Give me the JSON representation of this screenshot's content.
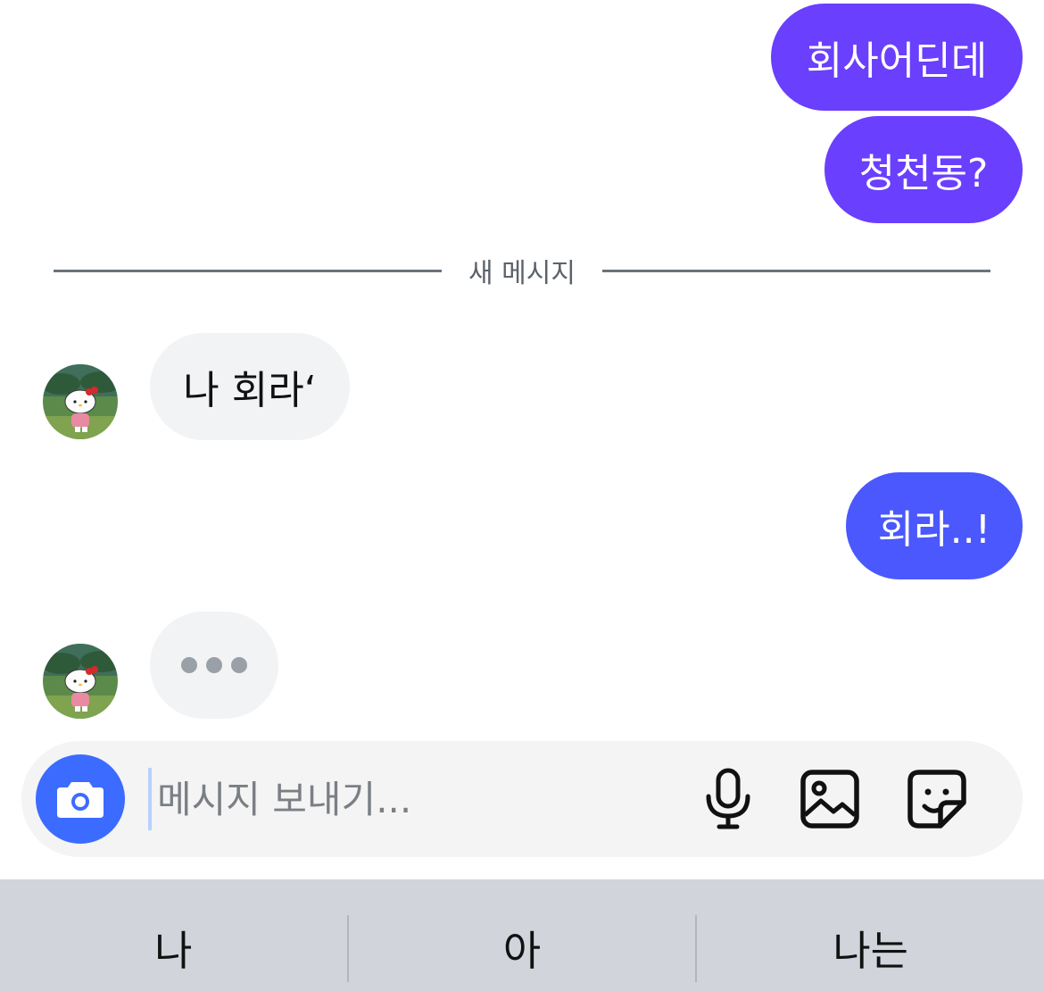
{
  "colors": {
    "outgoing_bubble_1": "#6a3ffd",
    "outgoing_bubble_2": "#6a3ffd",
    "outgoing_bubble_3": "#4b58fd",
    "incoming_bubble": "#f2f3f5",
    "camera_button": "#3b6cff",
    "divider_line": "#6b737c",
    "suggestion_bar": "#d1d4da"
  },
  "messages": [
    {
      "direction": "out",
      "text": "회사어딘데"
    },
    {
      "direction": "out",
      "text": "청천동?"
    },
    {
      "direction": "in",
      "text": "나 회라‘"
    },
    {
      "direction": "out",
      "text": "회라..!"
    }
  ],
  "divider": {
    "label": "새 메시지"
  },
  "typing_indicator": {
    "icon": "typing-dots"
  },
  "composer": {
    "placeholder": "메시지 보내기...",
    "value": "",
    "icons": [
      "camera-icon",
      "microphone-icon",
      "image-icon",
      "sticker-icon"
    ]
  },
  "suggestions": [
    "나",
    "아",
    "나는"
  ]
}
